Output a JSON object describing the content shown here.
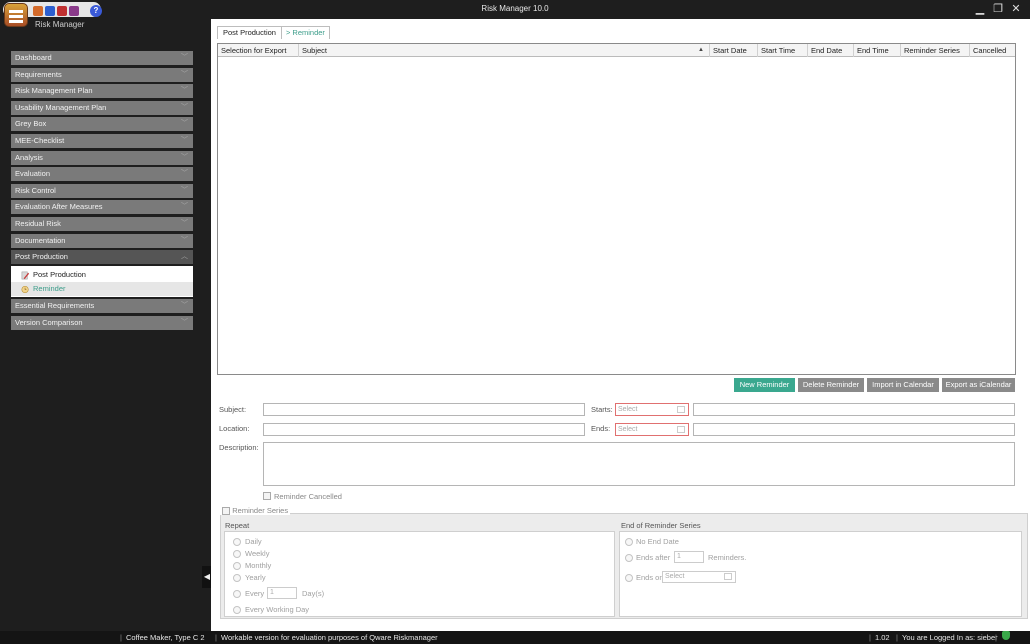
{
  "window": {
    "title": "Risk Manager  10.0",
    "module_title": "Risk Manager",
    "controls": {
      "minimize": "▁",
      "maximize": "❐",
      "close": "✕"
    }
  },
  "icons": {
    "app_logo": "app-logo-icon",
    "help": "?"
  },
  "sidebar": {
    "items": [
      {
        "label": "Dashboard"
      },
      {
        "label": "Requirements"
      },
      {
        "label": "Risk Management Plan"
      },
      {
        "label": "Usability Management Plan"
      },
      {
        "label": "Grey Box"
      },
      {
        "label": "MEE-Checklist"
      },
      {
        "label": "Analysis"
      },
      {
        "label": "Evaluation"
      },
      {
        "label": "Risk Control"
      },
      {
        "label": "Evaluation After Measures"
      },
      {
        "label": "Residual Risk"
      },
      {
        "label": "Documentation"
      },
      {
        "label": "Post Production",
        "expanded": true,
        "subitems": [
          {
            "label": "Post Production"
          },
          {
            "label": "Reminder",
            "active": true
          }
        ]
      },
      {
        "label": "Essential Requirements"
      },
      {
        "label": "Version Comparison"
      }
    ],
    "chevron_down": "﹀",
    "chevron_up": "︿",
    "collapse": "◀"
  },
  "breadcrumb": {
    "root": "Post Production",
    "current": "> Reminder"
  },
  "grid": {
    "columns": [
      "Selection for Export",
      "Subject",
      "Start Date",
      "Start Time",
      "End Date",
      "End Time",
      "Reminder Series",
      "Cancelled"
    ],
    "sort_indicator": "▲",
    "rows": []
  },
  "buttons": {
    "new": "New Reminder",
    "delete": "Delete Reminder",
    "import": "Import in Calendar",
    "export": "Export as iCalendar"
  },
  "form": {
    "subject_label": "Subject:",
    "location_label": "Location:",
    "description_label": "Description:",
    "starts_label": "Starts:",
    "ends_label": "Ends:",
    "date_placeholder": "Select",
    "cancelled_label": "Reminder Cancelled"
  },
  "series": {
    "label": "Reminder Series",
    "repeat_title": "Repeat",
    "repeat_options": [
      "Daily",
      "Weekly",
      "Monthly",
      "Yearly"
    ],
    "every_label": "Every",
    "every_value": "1",
    "every_unit": "Day(s)",
    "every_working_day": "Every Working Day",
    "end_title": "End of Reminder Series",
    "no_end_date": "No End Date",
    "ends_after": "Ends after",
    "ends_after_value": "1",
    "reminders_label": "Reminders.",
    "ends_on": "Ends on",
    "ends_on_placeholder": "Select"
  },
  "statusbar": {
    "project": "Coffee Maker, Type C 2",
    "message": "Workable version for evaluation purposes of Qware Riskmanager",
    "version": "1.02",
    "user": "You are Logged In as: sieber"
  },
  "colors": {
    "accent": "#3aa88f",
    "nav": "#7a7a7a",
    "button": "#8a8a8a"
  }
}
